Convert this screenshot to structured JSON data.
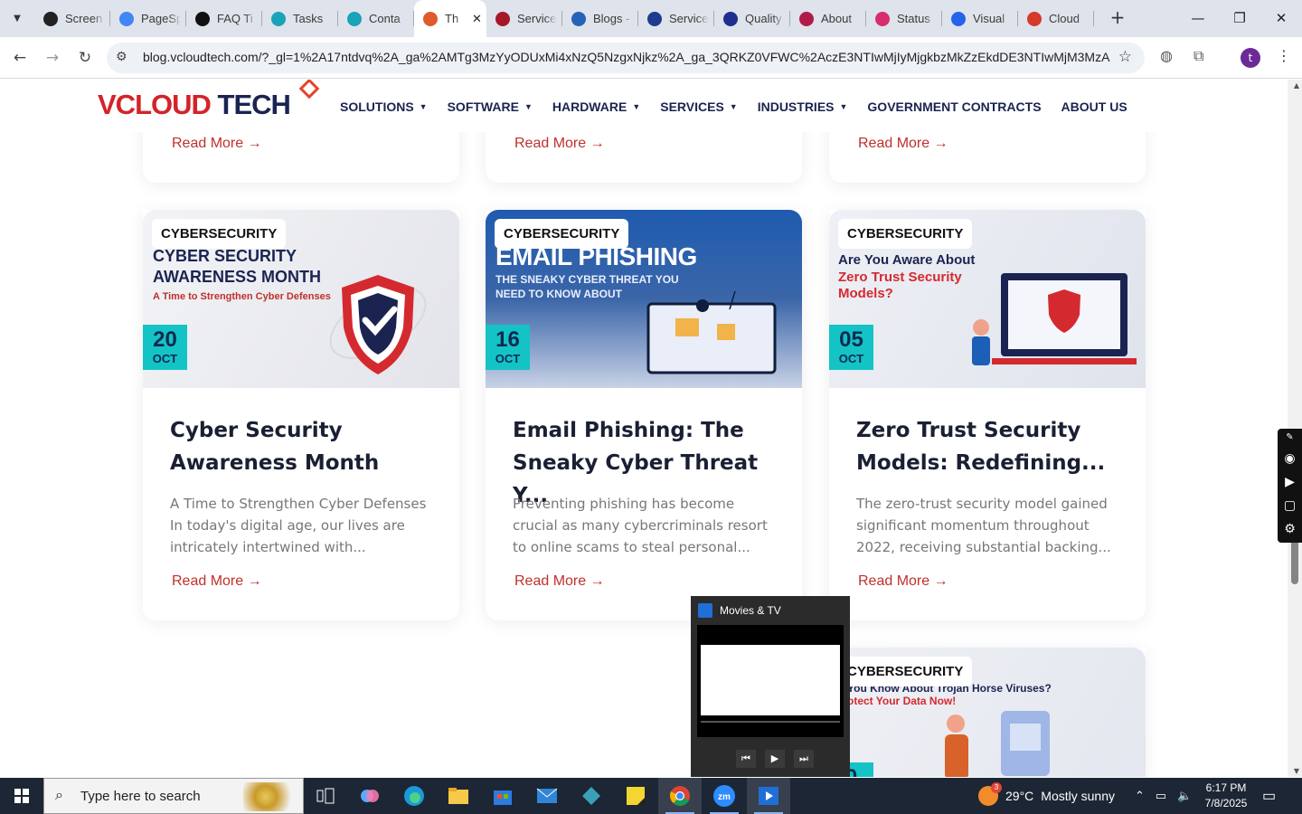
{
  "browser": {
    "tabs": [
      {
        "title": "Screen",
        "color": "#222"
      },
      {
        "title": "PageSp",
        "color": "#4285f4"
      },
      {
        "title": "FAQ Ti",
        "color": "#111"
      },
      {
        "title": "Tasks",
        "color": "#1aa3b8"
      },
      {
        "title": "Conta",
        "color": "#1aa3b8"
      },
      {
        "title": "Th",
        "color": "#e05a2b",
        "active": true
      },
      {
        "title": "Service",
        "color": "#a7172a"
      },
      {
        "title": "Blogs -",
        "color": "#2563b8"
      },
      {
        "title": "Service",
        "color": "#1d3b8f"
      },
      {
        "title": "Quality",
        "color": "#1e2f8f"
      },
      {
        "title": "About",
        "color": "#b01b4a"
      },
      {
        "title": "Status",
        "color": "#d92d6d"
      },
      {
        "title": "Visual",
        "color": "#2563eb"
      },
      {
        "title": "Cloud",
        "color": "#d63a2b"
      }
    ],
    "url": "blog.vcloudtech.com/?_gl=1%2A17ntdvq%2A_ga%2AMTg3MzYyODUxMi4xNzQ5NzgxNjkz%2A_ga_3QRKZ0VFWC%2AczE3NTIwMjIyMjgkbzMkZzEkdDE3NTIwMjM3MzAka...",
    "profile_initial": "t"
  },
  "site": {
    "logo_part1": "VCLOUD",
    "logo_part2": "TECH",
    "menu": [
      {
        "label": "SOLUTIONS",
        "dropdown": true
      },
      {
        "label": "SOFTWARE",
        "dropdown": true
      },
      {
        "label": "HARDWARE",
        "dropdown": true
      },
      {
        "label": "SERVICES",
        "dropdown": true
      },
      {
        "label": "INDUSTRIES",
        "dropdown": true
      },
      {
        "label": "GOVERNMENT CONTRACTS",
        "dropdown": false
      },
      {
        "label": "ABOUT US",
        "dropdown": false
      }
    ]
  },
  "read_more": "Read More →",
  "posts": [
    {
      "category": "CYBERSECURITY",
      "day": "20",
      "month": "OCT",
      "title": "Cyber Security Awareness Month",
      "excerpt": "A Time to Strengthen Cyber Defenses In today's digital age, our lives are intricately intertwined with...",
      "img_heading": "CYBER SECURITY AWARENESS MONTH",
      "img_sub": "A Time to Strengthen Cyber Defenses"
    },
    {
      "category": "CYBERSECURITY",
      "day": "16",
      "month": "OCT",
      "title": "Email Phishing: The Sneaky Cyber Threat Y...",
      "excerpt": "Preventing phishing has become crucial as many cybercriminals resort to online scams to steal personal...",
      "img_heading": "EMAIL PHISHING",
      "img_sub": "THE SNEAKY CYBER THREAT YOU NEED TO KNOW ABOUT"
    },
    {
      "category": "CYBERSECURITY",
      "day": "05",
      "month": "OCT",
      "title": "Zero Trust Security Models: Redefining...",
      "excerpt": "The zero-trust security model gained significant momentum throughout 2022, receiving substantial backing...",
      "img_heading": "Are You Aware About",
      "img_sub": "Zero Trust Security Models?"
    },
    {
      "category": "CYBERSECURITY",
      "day": "0",
      "img_heading": "You Know About Trojan Horse Viruses?",
      "img_sub": "otect Your Data Now!"
    }
  ],
  "flyout": {
    "title": "Movies & TV"
  },
  "taskbar": {
    "search_placeholder": "Type here to search",
    "weather_temp": "29°C",
    "weather_text": "Mostly sunny",
    "weather_badge": "3",
    "time": "6:17 PM",
    "date": "7/8/2025"
  }
}
